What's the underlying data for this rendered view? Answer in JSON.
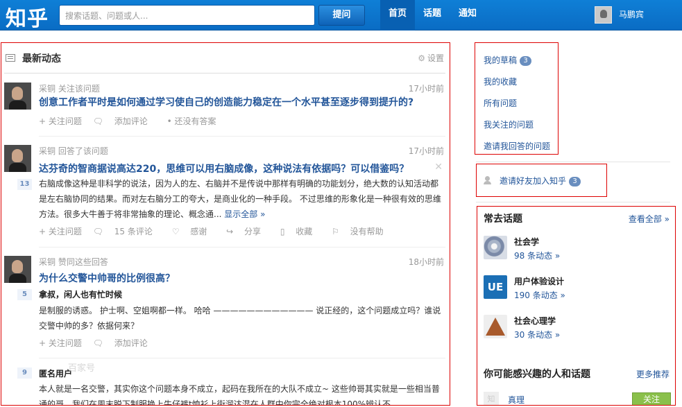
{
  "header": {
    "logo": "知乎",
    "search_placeholder": "搜索话题、问题或人...",
    "ask_button": "提问",
    "nav": [
      "首页",
      "话题",
      "通知"
    ],
    "user_name": "马鹏宾"
  },
  "feed": {
    "title": "最新动态",
    "settings": "设置",
    "items": [
      {
        "meta": "采铜 关注该问题",
        "time": "17小时前",
        "title": "创意工作者平时是如何通过学习使自己的创造能力稳定在一个水平甚至逐步得到提升的?",
        "actions": [
          "+ 关注问题",
          "添加评论",
          "• 还没有答案"
        ]
      },
      {
        "meta": "采铜 回答了该问题",
        "time": "17小时前",
        "title": "达芬奇的智商据说高达220，思维可以用右脑成像，这种说法有依据吗？可以借鉴吗？",
        "votes": "13",
        "body": "右脑成像这种是非科学的说法，因为人的左、右脑并不是传说中那样有明确的功能划分，绝大数的认知活动都是左右脑协同的结果。而对左右脑分工的夸大，是商业化的一种手段。 不过思维的形象化是一种很有效的思维方法。很多大牛善于将非常抽象的理论、概念通...",
        "show_all": "显示全部 »",
        "actions": [
          "+ 关注问题",
          "15 条评论",
          "感谢",
          "分享",
          "收藏",
          "没有帮助"
        ]
      },
      {
        "meta": "采铜 赞同这些回答",
        "time": "18小时前",
        "title": "为什么交警中帅哥的比例很高？",
        "votes": "5",
        "author": "拿叔，闲人也有忙时候",
        "body": "是制服的诱惑。 护士啊、空姐啊都一样。 哈哈 ———————————— 说正经的，这个问题成立吗？谁说交警中帅的多？依据何来？",
        "actions": [
          "+ 关注问题",
          "添加评论"
        ]
      },
      {
        "votes": "9",
        "author": "匿名用户",
        "body": "本人就是一名交警，其实你这个问题本身不成立，起码在我所在的大队不成立~ 这些帅哥其实就是一些相当普通的哥，我们在周末脱下制服换上牛仔裤t恤衫上街溜达混在人群中你完全绝对根本100%辨认不"
      }
    ]
  },
  "sidebar": {
    "links": [
      {
        "label": "我的草稿",
        "badge": "3"
      },
      {
        "label": "我的收藏"
      },
      {
        "label": "所有问题"
      },
      {
        "label": "我关注的问题"
      },
      {
        "label": "邀请我回答的问题"
      }
    ],
    "invite": {
      "label": "邀请好友加入知乎",
      "badge": "3"
    },
    "topics_title": "常去话题",
    "see_all": "查看全部 »",
    "topics": [
      {
        "name": "社会学",
        "count": "98 条动态 »"
      },
      {
        "name": "用户体验设计",
        "count": "190 条动态 »",
        "icon_text": "UE"
      },
      {
        "name": "社会心理学",
        "count": "30 条动态 »"
      }
    ],
    "interest_title": "你可能感兴趣的人和话题",
    "more_rec": "更多推荐",
    "person": {
      "name": "真理",
      "icon_text": "知",
      "follow": "关注"
    }
  },
  "watermark": "百家号"
}
